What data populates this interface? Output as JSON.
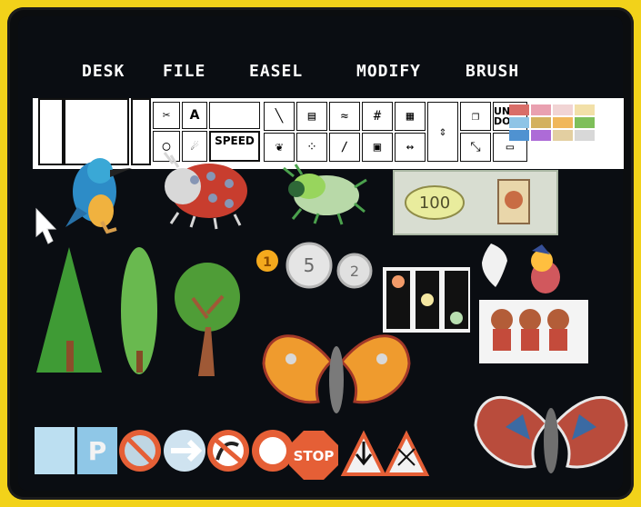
{
  "menu": {
    "desk": "DESK",
    "file": "FILE",
    "easel": "EASEL",
    "modify": "MODIFY",
    "brush": "BRUSH"
  },
  "toolbar": {
    "speed_label": "SPEED",
    "undo_label": "UN DO",
    "text_tool_label": "A",
    "swatch_colors": [
      "#d96d68",
      "#e9a0b0",
      "#f1d4d4",
      "#f2e0a8",
      "#8ec4e6",
      "#d3b15e",
      "#f0b75b",
      "#7ebf5a",
      "#4f92d1",
      "#ad6bd7",
      "#e3cfa1",
      "#d8d8d8"
    ]
  },
  "canvas": {
    "coins": [
      "1",
      "5",
      "2"
    ],
    "banknote_value": "100",
    "stop_sign": "STOP"
  },
  "colors": {
    "frame": "#f2d21a",
    "screen": "#0a0d12",
    "menu_text": "#ffffff"
  }
}
